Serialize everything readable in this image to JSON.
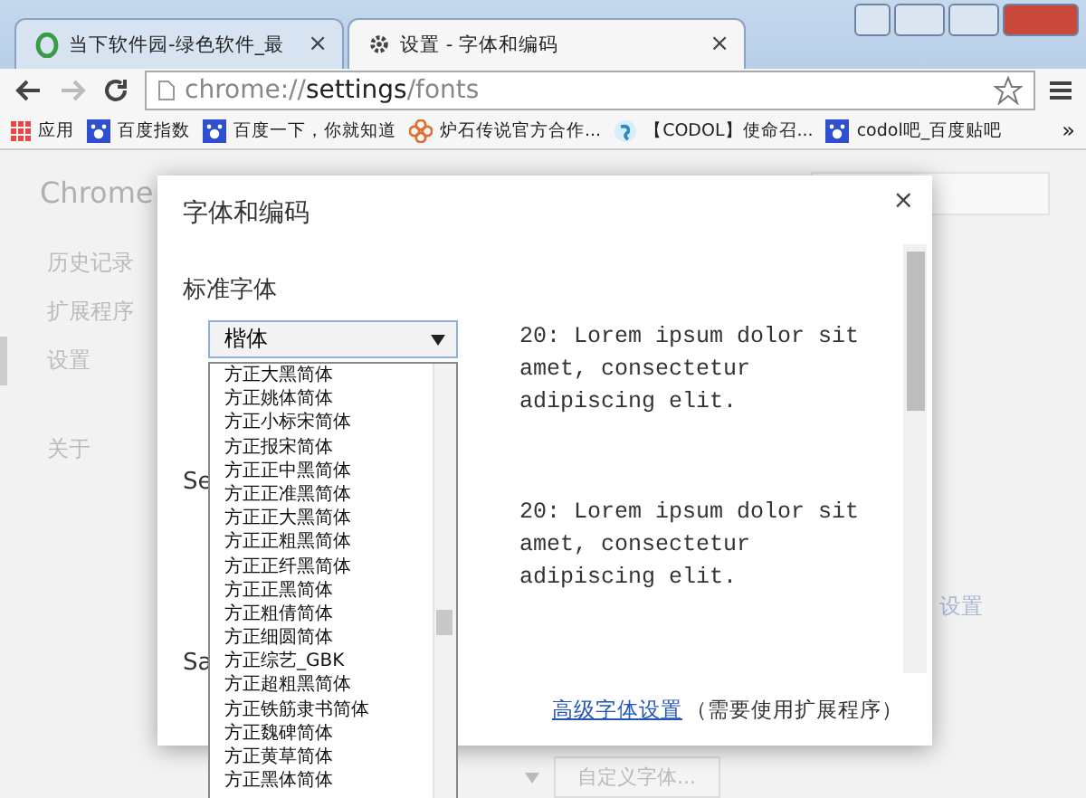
{
  "tabs": [
    {
      "title": "当下软件园-绿色软件_最",
      "selected": false,
      "close": "×"
    },
    {
      "title": "设置 - 字体和编码",
      "selected": true,
      "close": "×"
    }
  ],
  "address": {
    "scheme": "chrome://",
    "host": "settings",
    "path": "/fonts"
  },
  "bookmarks": [
    {
      "label": "应用",
      "kind": "apps"
    },
    {
      "label": "百度指数",
      "kind": "paw"
    },
    {
      "label": "百度一下，你就知道",
      "kind": "paw"
    },
    {
      "label": "炉石传说官方合作...",
      "kind": "flower"
    },
    {
      "label": "【CODOL】使命召...",
      "kind": "swirl"
    },
    {
      "label": "codol吧_百度贴吧",
      "kind": "paw"
    }
  ],
  "bookmarks_more": "»",
  "page": {
    "brand": "Chrome",
    "nav": [
      {
        "label": "历史记录",
        "selected": false
      },
      {
        "label": "扩展程序",
        "selected": false
      },
      {
        "label": "设置",
        "selected": true
      },
      {
        "label": "关于",
        "selected": false
      }
    ],
    "right_link": "设置",
    "bottom_button": "自定义字体..."
  },
  "dialog": {
    "title": "字体和编码",
    "close": "×",
    "sections": [
      {
        "label": "标准字体",
        "value": "楷体",
        "preview": "20: Lorem ipsum dolor sit amet, consectetur adipiscing elit."
      },
      {
        "label": "Se",
        "preview": "20: Lorem ipsum dolor sit amet, consectetur adipiscing elit."
      },
      {
        "label": "Sa"
      }
    ],
    "footer_link": "高级字体设置",
    "footer_note": "（需要使用扩展程序）"
  },
  "dropdown": {
    "options": [
      "方正大黑简体",
      "方正姚体简体",
      "方正小标宋简体",
      "方正报宋简体",
      "方正正中黑简体",
      "方正正准黑简体",
      "方正正大黑简体",
      "方正正粗黑简体",
      "方正正纤黑简体",
      "方正正黑简体",
      "方正粗倩简体",
      "方正细圆简体",
      "方正综艺_GBK",
      "方正超粗黑简体",
      "方正铁筋隶书简体",
      "方正魏碑简体",
      "方正黄草简体",
      "方正黑体简体"
    ]
  }
}
